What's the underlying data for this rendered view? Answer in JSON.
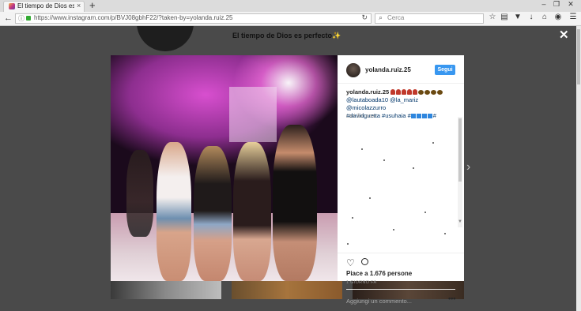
{
  "browser": {
    "tab_title": "El tiempo de Dios es perfecto",
    "tab_close": "×",
    "new_tab": "+",
    "window_minimize": "–",
    "window_maximize": "❐",
    "window_close": "✕",
    "url": "https://www.instagram.com/p/BVJ08gbhF22/?taken-by=yolanda.ruiz.25",
    "search_placeholder": "Cerca",
    "icons": [
      "star-icon",
      "reader-icon",
      "pocket-icon",
      "download-icon",
      "home-icon",
      "sync-icon",
      "menu-icon"
    ]
  },
  "background_page": {
    "bio": "El tiempo de Dios es perfecto✨"
  },
  "modal": {
    "close": "✕",
    "next": "›",
    "username": "yolanda.ruiz.25",
    "follow_label": "Segui",
    "caption_username": "yolanda.ruiz.25",
    "caption_mentions": "@lautaboada10 @la_mariz @micolazzurro",
    "caption_tags": "#davidguetta #usuhaia #",
    "comment_stub": "cari     ibri com",
    "likes_text": "Piace a 1.676 persone",
    "date_text": "1 GIORNO FA",
    "add_comment_placeholder": "Aggiungi un commento...",
    "more_label": "•••"
  },
  "colors": {
    "overlay": "#4a4a4a",
    "follow_button": "#3897f0",
    "link": "#003569"
  }
}
